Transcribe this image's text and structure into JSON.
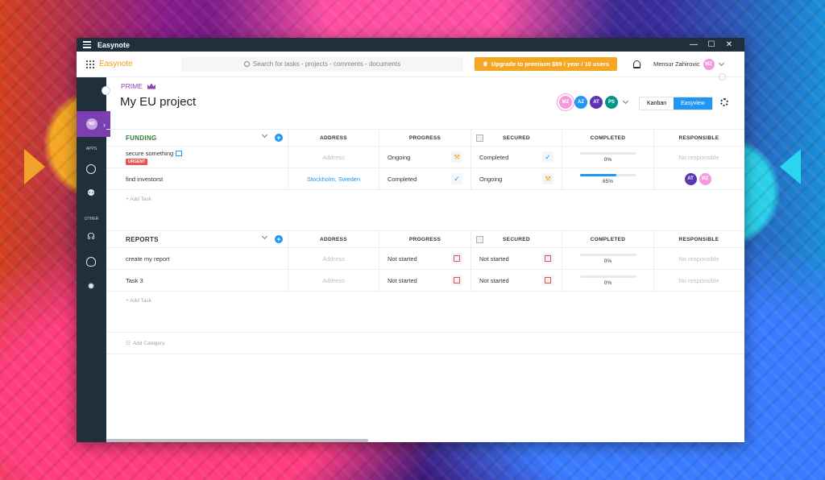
{
  "window": {
    "title": "Easynote"
  },
  "topbar": {
    "brand": "Easynote",
    "search_placeholder": "Search for tasks - projects - comments - documents",
    "upgrade_label": "Upgrade to premium $99 / year / 10 users",
    "user_name": "Mensur Zahirovic",
    "user_initials": "MZ"
  },
  "sidebar": {
    "active_initials": "MZ",
    "label_apps": "APPS",
    "label_other": "OTHER"
  },
  "project": {
    "tier": "PRIME",
    "title": "My EU project",
    "members": [
      "MZ",
      "AZ",
      "AT",
      "PS"
    ],
    "views": [
      "Kanban",
      "Easyview"
    ],
    "active_view": "Easyview"
  },
  "columns": {
    "address": "ADDRESS",
    "progress": "PROGRESS",
    "secured": "SECURED",
    "completed": "COMPLETED",
    "responsible": "RESPONSIBLE"
  },
  "sections": [
    {
      "name": "FUNDING",
      "add_task": "+ Add Task",
      "tasks": [
        {
          "name": "secure something",
          "badge": "URGENT",
          "address": "Address",
          "progress": "Ongoing",
          "secured": "Completed",
          "completed": "0%",
          "completed_value": 0,
          "responsible": "No responsible"
        },
        {
          "name": "find investorst",
          "address": "Stockholm, Sweden",
          "progress": "Completed",
          "secured": "Ongoing",
          "completed": "65%",
          "completed_value": 65,
          "responsible_avatars": [
            "AT",
            "MZ"
          ]
        }
      ]
    },
    {
      "name": "REPORTS",
      "add_task": "+ Add Task",
      "tasks": [
        {
          "name": "create my report",
          "address": "Address",
          "progress": "Not started",
          "secured": "Not started",
          "completed": "0%",
          "completed_value": 0,
          "responsible": "No responsible"
        },
        {
          "name": "Task 3",
          "address": "Address",
          "progress": "Not started",
          "secured": "Not started",
          "completed": "0%",
          "completed_value": 0,
          "responsible": "No responsible"
        }
      ]
    }
  ],
  "add_category": "Add Category",
  "colors": {
    "accent": "#2196f3",
    "brand": "#f39c12",
    "prime": "#8e44ad",
    "sidebar": "#1f2f3c",
    "urgent": "#ef5350"
  }
}
